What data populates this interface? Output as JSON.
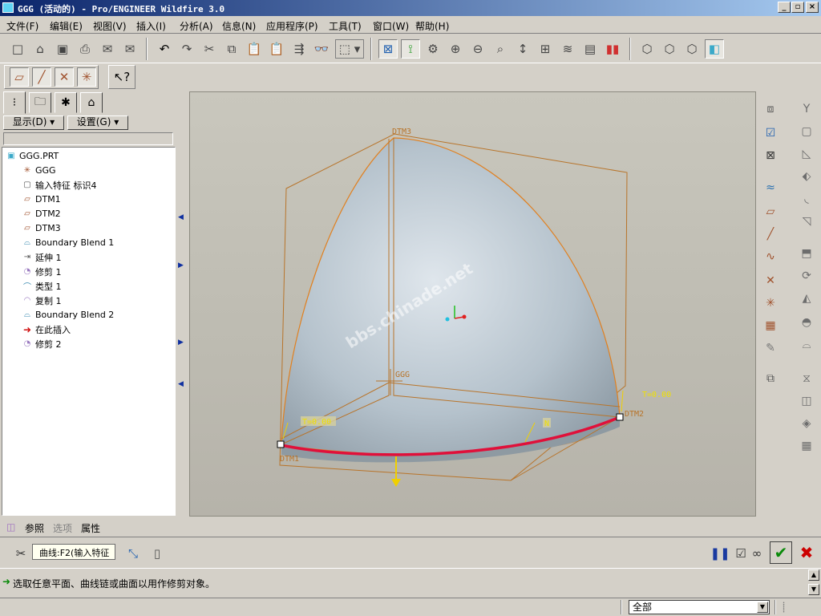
{
  "window": {
    "title": "GGG (活动的) - Pro/ENGINEER Wildfire 3.0",
    "min_label": "_",
    "max_label": "▫",
    "close_label": "×"
  },
  "menu": [
    "文件(F)",
    "编辑(E)",
    "视图(V)",
    "插入(I)",
    "分析(A)",
    "信息(N)",
    "应用程序(P)",
    "工具(T)",
    "窗口(W)",
    "帮助(H)"
  ],
  "panel": {
    "display_label": "显示(D) ▾",
    "settings_label": "设置(G) ▾"
  },
  "model_tree": {
    "root": "GGG.PRT",
    "items": [
      {
        "label": "GGG",
        "icon": "csys-icon"
      },
      {
        "label": "输入特征 标识4",
        "icon": "import-feature-icon"
      },
      {
        "label": "DTM1",
        "icon": "datum-plane-icon"
      },
      {
        "label": "DTM2",
        "icon": "datum-plane-icon"
      },
      {
        "label": "DTM3",
        "icon": "datum-plane-icon"
      },
      {
        "label": "Boundary Blend 1",
        "icon": "boundary-blend-icon"
      },
      {
        "label": "延伸 1",
        "icon": "extend-icon"
      },
      {
        "label": "修剪 1",
        "icon": "trim-icon"
      },
      {
        "label": "类型 1",
        "icon": "style-icon"
      },
      {
        "label": "复制 1",
        "icon": "copy-icon"
      },
      {
        "label": "Boundary Blend 2",
        "icon": "boundary-blend-icon"
      },
      {
        "label": "在此插入",
        "icon": "insert-here-arrow-icon"
      },
      {
        "label": "修剪 2",
        "icon": "trim-icon"
      }
    ]
  },
  "graphics": {
    "labels": {
      "dtm1": "DTM1",
      "dtm2": "DTM2",
      "dtm3": "DTM3",
      "csys": "GGG",
      "t_left": "T=0.00",
      "t_right": "T=0.00",
      "n": "N"
    },
    "watermark": "bbs.chinade.net"
  },
  "dashboard": {
    "tabs": [
      "参照",
      "选项",
      "属性"
    ],
    "curve_field": "曲线:F2(输入特征",
    "message": "选取任意平面、曲线链或曲面以用作修剪对象。",
    "filter_value": "全部"
  },
  "colors": {
    "titlebar": "#0a246a",
    "surface": "#aebcc6",
    "trim_curve": "#e0103a",
    "datum": "#b8742a",
    "ok_green": "#0a8a0a",
    "cancel_red": "#cc0000"
  }
}
